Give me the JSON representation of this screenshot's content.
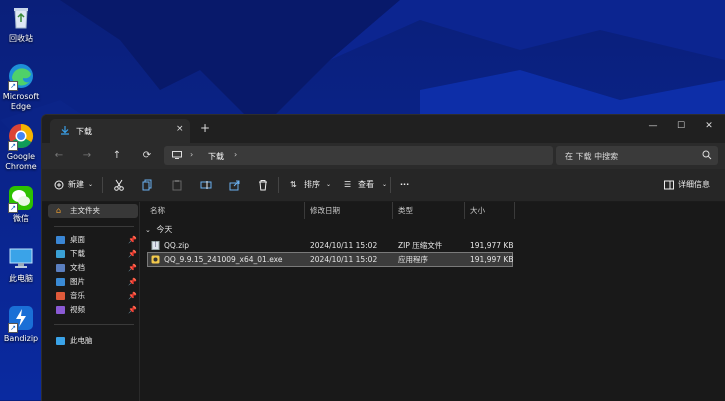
{
  "desktop": {
    "icons": [
      {
        "label": "回收站"
      },
      {
        "label": "Microsoft Edge"
      },
      {
        "label": "Google Chrome"
      },
      {
        "label": "微信"
      },
      {
        "label": "此电脑"
      },
      {
        "label": "Bandizip"
      }
    ]
  },
  "window": {
    "tab_title": "下载",
    "tab_close": "×",
    "new_tab": "+",
    "controls": {
      "minimize": "—",
      "maximize": "☐",
      "close": "✕"
    }
  },
  "address_bar": {
    "back": "←",
    "forward": "→",
    "up": "↑",
    "refresh": "⟳",
    "separator": "›",
    "crumb": "下载",
    "search_placeholder": "在 下载 中搜索"
  },
  "toolbar": {
    "new_label": "新建",
    "sort_label": "排序",
    "view_label": "查看",
    "more_label": "···",
    "details_label": "详细信息"
  },
  "sidebar": {
    "home": "主文件夹",
    "items": [
      {
        "label": "桌面",
        "color": "#3a86d4"
      },
      {
        "label": "下载",
        "color": "#3aa0d4"
      },
      {
        "label": "文档",
        "color": "#5b7fbf"
      },
      {
        "label": "图片",
        "color": "#3a8ad4"
      },
      {
        "label": "音乐",
        "color": "#e05a3a"
      },
      {
        "label": "视频",
        "color": "#8a5ad4"
      }
    ],
    "pin": "📌",
    "this_pc": "此电脑"
  },
  "files": {
    "columns": {
      "name": "名称",
      "modified": "修改日期",
      "type": "类型",
      "size": "大小"
    },
    "group": "今天",
    "rows": [
      {
        "name": "QQ.zip",
        "modified": "2024/10/11 15:02",
        "type": "ZIP 压缩文件",
        "size": "191,977 KB"
      },
      {
        "name": "QQ_9.9.15_241009_x64_01.exe",
        "modified": "2024/10/11 15:02",
        "type": "应用程序",
        "size": "191,997 KB"
      }
    ]
  }
}
